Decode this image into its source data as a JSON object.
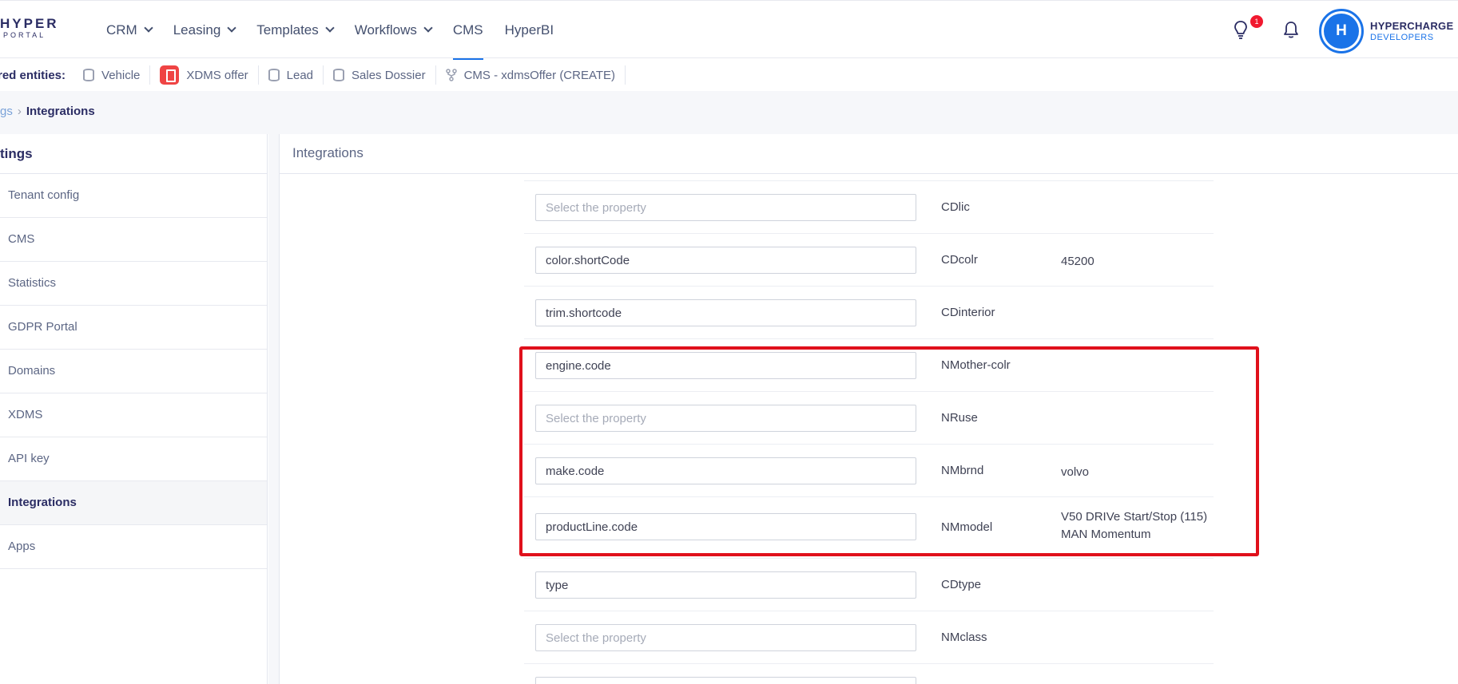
{
  "nav": {
    "logo_top": "HYPER",
    "logo_bottom": "PORTAL",
    "items": [
      {
        "label": "CRM",
        "dropdown": true
      },
      {
        "label": "Leasing",
        "dropdown": true
      },
      {
        "label": "Templates",
        "dropdown": true
      },
      {
        "label": "Workflows",
        "dropdown": true
      },
      {
        "label": "CMS",
        "dropdown": false,
        "active": true
      },
      {
        "label": "HyperBI",
        "dropdown": false
      }
    ],
    "notification_badge": "1",
    "avatar_letter": "H",
    "company_name": "HYPERCHARGE",
    "company_sub": "DEVELOPERS"
  },
  "favorites": {
    "label": "red entities:",
    "items": [
      {
        "label": "Vehicle",
        "icon": "database-icon"
      },
      {
        "label": "XDMS offer",
        "icon": "document-icon"
      },
      {
        "label": "Lead",
        "icon": "database-icon"
      },
      {
        "label": "Sales Dossier",
        "icon": "database-icon"
      },
      {
        "label": "CMS - xdmsOffer (CREATE)",
        "icon": "workflow-icon"
      }
    ]
  },
  "breadcrumb": {
    "parent": "gs",
    "current": "Integrations"
  },
  "sidebar": {
    "title": "tings",
    "items": [
      {
        "label": "Tenant config"
      },
      {
        "label": "CMS"
      },
      {
        "label": "Statistics"
      },
      {
        "label": "GDPR Portal"
      },
      {
        "label": "Domains"
      },
      {
        "label": "XDMS"
      },
      {
        "label": "API key"
      },
      {
        "label": "Integrations",
        "active": true
      },
      {
        "label": "Apps"
      }
    ]
  },
  "panel": {
    "title": "Integrations",
    "placeholder": "Select the property",
    "rows": [
      {
        "value": "",
        "code": "CDlic",
        "sample": ""
      },
      {
        "value": "color.shortCode",
        "code": "CDcolr",
        "sample": "45200"
      },
      {
        "value": "trim.shortcode",
        "code": "CDinterior",
        "sample": ""
      },
      {
        "value": "engine.code",
        "code": "NMother-colr",
        "sample": ""
      },
      {
        "value": "",
        "code": "NRuse",
        "sample": ""
      },
      {
        "value": "make.code",
        "code": "NMbrnd",
        "sample": "volvo"
      },
      {
        "value": "productLine.code",
        "code": "NMmodel",
        "sample": "V50 DRIVe Start/Stop (115) MAN Momentum"
      },
      {
        "value": "type",
        "code": "CDtype",
        "sample": ""
      },
      {
        "value": "",
        "code": "NMclass",
        "sample": ""
      },
      {
        "value": "",
        "code": "",
        "sample": ""
      }
    ]
  },
  "colors": {
    "accent": "#1a73e8",
    "highlight": "#e0101b",
    "badge": "#f1192f"
  }
}
